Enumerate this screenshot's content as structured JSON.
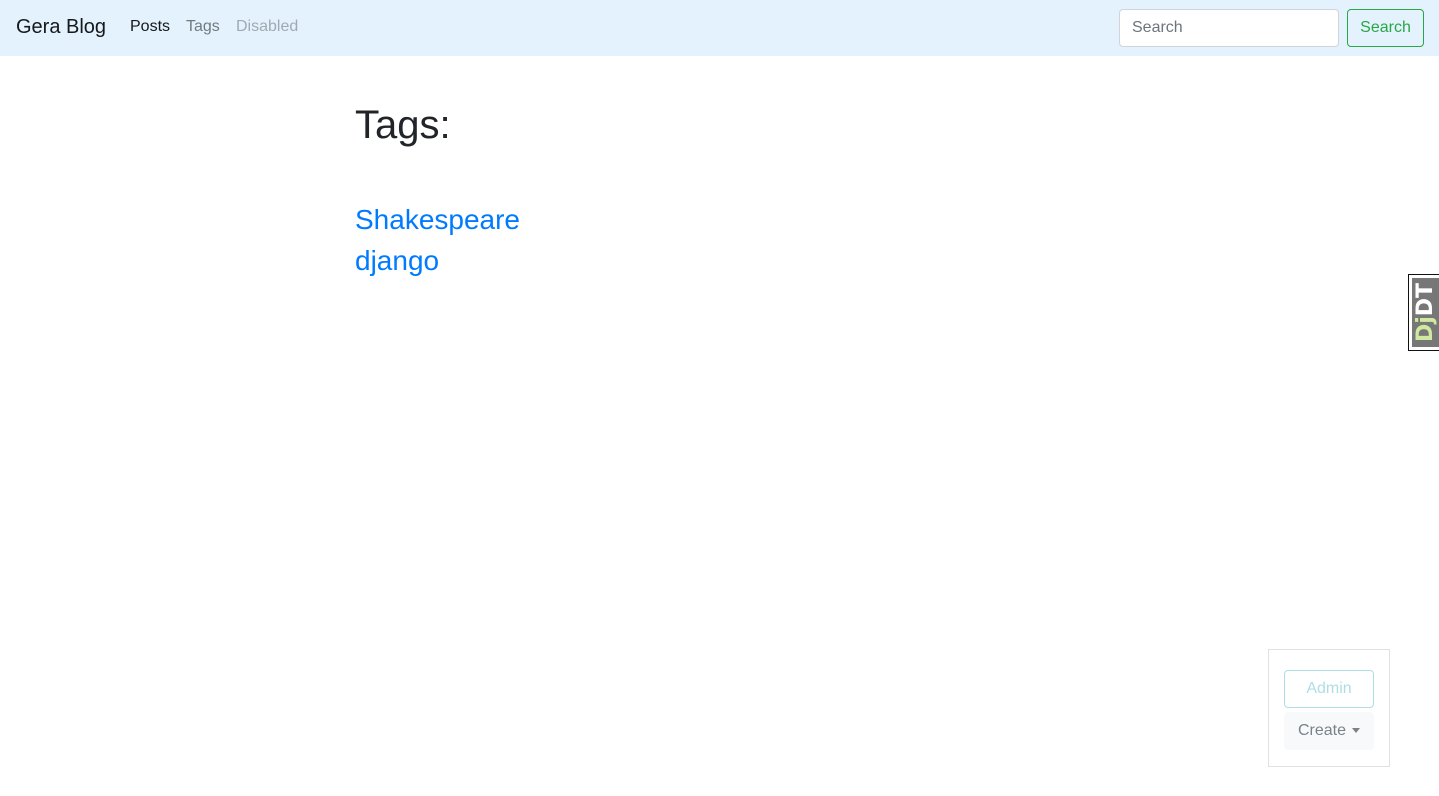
{
  "navbar": {
    "brand": "Gera Blog",
    "links": [
      {
        "label": "Posts",
        "state": "active"
      },
      {
        "label": "Tags",
        "state": "normal"
      },
      {
        "label": "Disabled",
        "state": "disabled"
      }
    ],
    "search": {
      "placeholder": "Search",
      "value": "",
      "button_label": "Search"
    },
    "background_color": "#e3f2fd"
  },
  "main": {
    "title": "Tags:",
    "tags": [
      {
        "label": "Shakespeare"
      },
      {
        "label": "django"
      }
    ]
  },
  "debug_toolbar": {
    "handle_prefix": "D",
    "handle_mid": "j",
    "handle_suffix": "DT"
  },
  "admin_panel": {
    "admin_label": "Admin",
    "create_label": "Create"
  },
  "colors": {
    "link": "#007bff",
    "success": "#28a745",
    "info": "#17a2b8",
    "muted": "#6c757d"
  }
}
